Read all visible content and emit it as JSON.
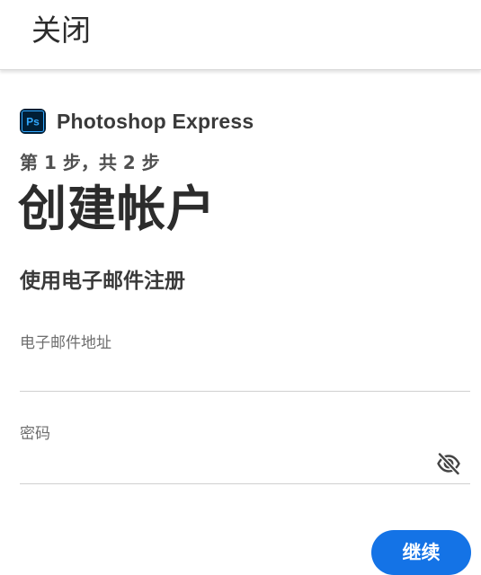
{
  "header": {
    "close_label": "关闭"
  },
  "brand": {
    "logo_text": "Ps",
    "name": "Photoshop Express"
  },
  "step": {
    "text": "第 1 步，共 2 步"
  },
  "page_title": "创建帐户",
  "section_heading": "使用电子邮件注册",
  "form": {
    "email": {
      "label": "电子邮件地址",
      "value": ""
    },
    "password": {
      "label": "密码",
      "value": "",
      "toggle_icon": "eye-slash-icon"
    }
  },
  "actions": {
    "continue_label": "继续"
  },
  "colors": {
    "accent": "#1473e6",
    "logo_bg": "#001e36",
    "logo_fg": "#31a8ff"
  }
}
